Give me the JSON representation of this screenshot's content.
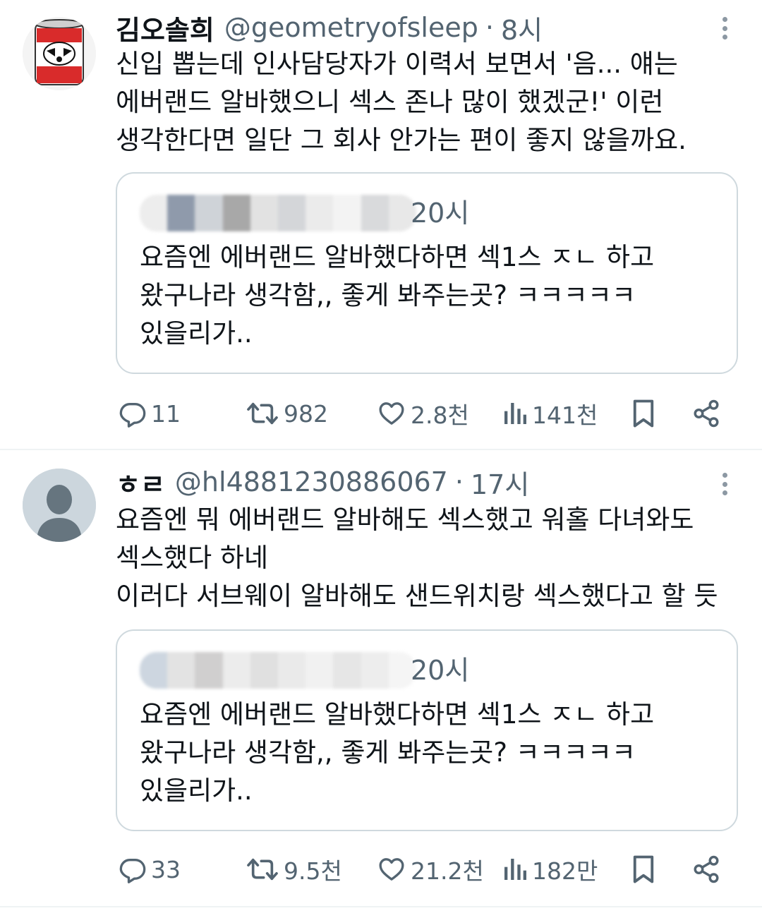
{
  "tweets": [
    {
      "author": {
        "display_name": "김오솔희",
        "handle": "@geometryofsleep",
        "avatar": "badger-can-avatar-icon"
      },
      "time": "8시",
      "separator": "·",
      "text_lines": [
        "신입 뽑는데 인사담당자가 이력서 보면서 '음... 얘는",
        "에버랜드 알바했으니 섹스 존나 많이 했겠군!' 이런",
        "생각한다면 일단 그 회사 안가는 편이 좋지 않을까요."
      ],
      "quote": {
        "time": "20시",
        "text_lines": [
          "요즘엔 에버랜드 알바했다하면 섹1스 ㅈㄴ 하고",
          "왔구나라 생각함,, 좋게 봐주는곳? ㅋㅋㅋㅋㅋ",
          "있을리가.."
        ]
      },
      "stats": {
        "replies": "11",
        "retweets": "982",
        "likes": "2.8천",
        "views": "141천"
      }
    },
    {
      "author": {
        "display_name": "ㅎㄹ",
        "handle": "@hl4881230886067",
        "avatar": "default-person-avatar-icon"
      },
      "time": "17시",
      "separator": "·",
      "text_lines": [
        "요즘엔 뭐 에버랜드 알바해도 섹스했고 워홀 다녀와도",
        "섹스했다 하네",
        "이러다 서브웨이 알바해도 샌드위치랑 섹스했다고 할 듯"
      ],
      "quote": {
        "time": "20시",
        "text_lines": [
          "요즘엔 에버랜드 알바했다하면 섹1스 ㅈㄴ 하고",
          "왔구나라 생각함,, 좋게 봐주는곳? ㅋㅋㅋㅋㅋ",
          "있을리가.."
        ]
      },
      "stats": {
        "replies": "33",
        "retweets": "9.5천",
        "likes": "21.2천",
        "views": "182만"
      }
    }
  ],
  "icons": [
    "reply-icon",
    "retweet-icon",
    "like-icon",
    "views-icon",
    "bookmark-icon",
    "share-icon",
    "more-options-icon"
  ],
  "colors": {
    "text": "#0f1419",
    "secondary": "#536471",
    "border": "#cfd9de",
    "divider": "#eff3f4"
  }
}
